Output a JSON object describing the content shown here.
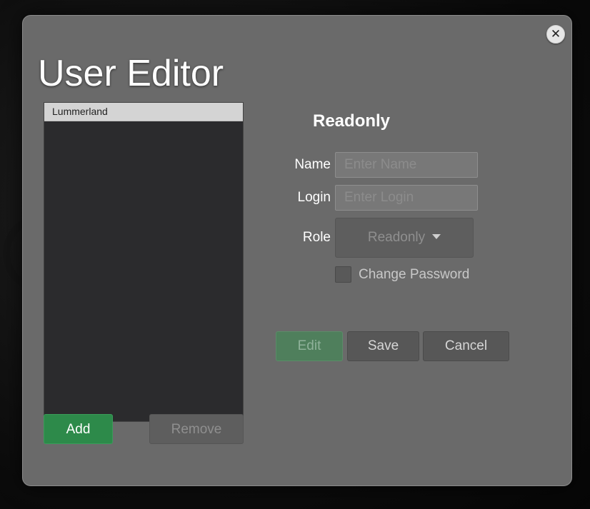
{
  "modal": {
    "title": "User Editor",
    "close_symbol": "✕",
    "close_icon": "close-icon"
  },
  "user_list": {
    "items": [
      "Lummerland"
    ],
    "selected": "Lummerland"
  },
  "list_actions": {
    "add_label": "Add",
    "remove_label": "Remove"
  },
  "form": {
    "title": "Readonly",
    "name_label": "Name",
    "name_value": "",
    "name_placeholder": "Enter Name",
    "login_label": "Login",
    "login_value": "",
    "login_placeholder": "Enter Login",
    "role_label": "Role",
    "role_value": "Readonly",
    "role_caret_icon": "caret-down-icon",
    "change_password_label": "Change Password",
    "change_password_checked": false
  },
  "form_actions": {
    "edit_label": "Edit",
    "save_label": "Save",
    "cancel_label": "Cancel"
  },
  "colors": {
    "accent_green": "#2d8a4a",
    "modal_bg": "#6a6a6a",
    "list_bg": "#2b2b2d",
    "selected_row": "#d4d4d4"
  }
}
